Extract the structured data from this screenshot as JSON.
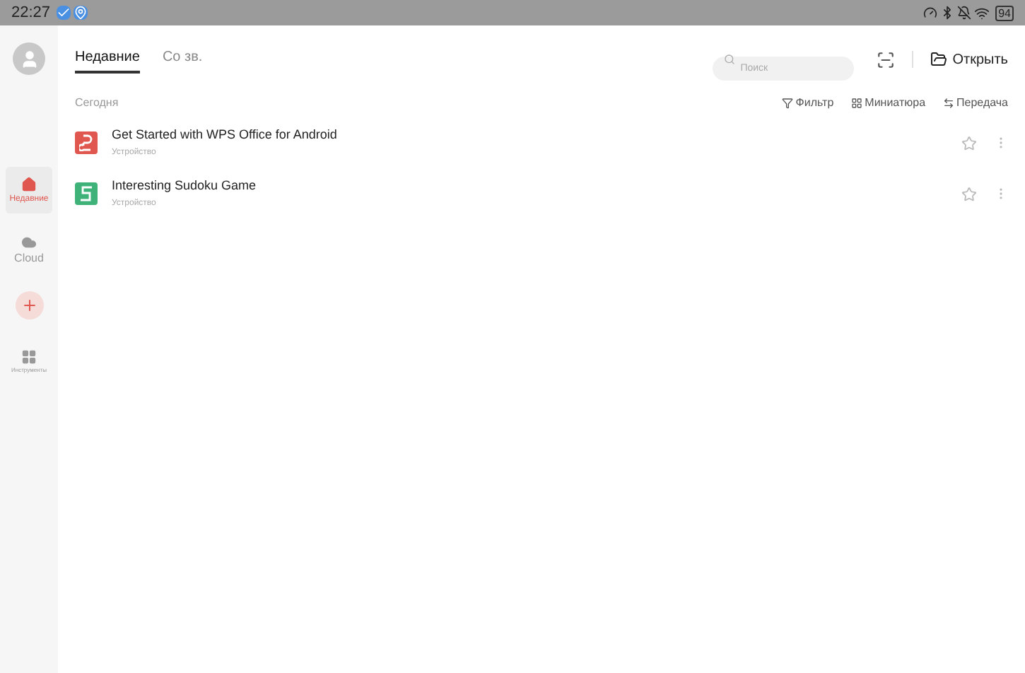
{
  "status_bar": {
    "time": "22:27",
    "battery": "94"
  },
  "sidebar": {
    "items": [
      {
        "kind": "recent",
        "label": "Недавние",
        "selected": true
      },
      {
        "kind": "cloud",
        "label": "Cloud",
        "selected": false
      },
      {
        "kind": "add"
      },
      {
        "kind": "tools",
        "label": "Инструменты",
        "selected": false
      }
    ]
  },
  "tabs": [
    {
      "label": "Недавние",
      "selected": true
    },
    {
      "label": "Со зв.",
      "selected": false
    }
  ],
  "search": {
    "placeholder": "Поиск"
  },
  "open_button": "Открыть",
  "section_title": "Сегодня",
  "toolbar": [
    {
      "kind": "filter",
      "label": "Фильтр"
    },
    {
      "kind": "thumbnails",
      "label": "Миниатюра"
    },
    {
      "kind": "transfer",
      "label": "Передача"
    }
  ],
  "files": [
    {
      "kind": "presentation",
      "name": "Get Started with WPS Office for Android",
      "location": "Устройство",
      "starred": false
    },
    {
      "kind": "spreadsheet",
      "name": "Interesting Sudoku Game",
      "location": "Устройство",
      "starred": false
    }
  ]
}
